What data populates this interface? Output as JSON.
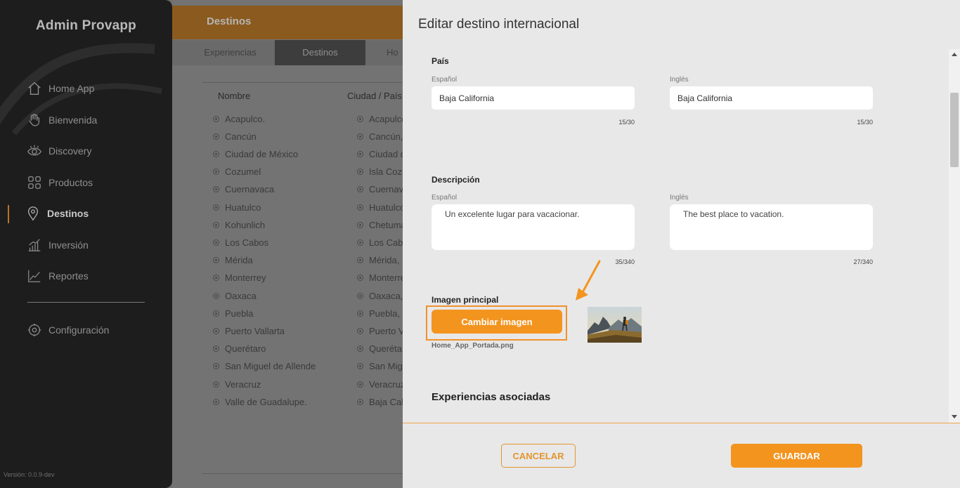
{
  "sidebar": {
    "app_title": "Admin Provapp",
    "items": [
      {
        "label": "Home App",
        "icon": "home-icon"
      },
      {
        "label": "Bienvenida",
        "icon": "wave-hand-icon"
      },
      {
        "label": "Discovery",
        "icon": "eye-icon"
      },
      {
        "label": "Productos",
        "icon": "grid-icon"
      },
      {
        "label": "Destinos",
        "icon": "location-pin-icon",
        "active": true
      },
      {
        "label": "Inversión",
        "icon": "bar-chart-icon"
      },
      {
        "label": "Reportes",
        "icon": "line-chart-icon"
      },
      {
        "label": "Configuración",
        "icon": "gear-icon"
      }
    ],
    "version": "Versión: 0.0.9-dev"
  },
  "background_page": {
    "header_title": "Destinos",
    "tabs": [
      "Experiencias",
      "Destinos",
      "Ho"
    ],
    "selected_tab": "Destinos",
    "columns": [
      "Nombre",
      "Ciudad / País"
    ],
    "rows": [
      [
        "Acapulco.",
        "Acapulco"
      ],
      [
        "Cancún",
        "Cancún,"
      ],
      [
        "Ciudad de México",
        "Ciudad d"
      ],
      [
        "Cozumel",
        "Isla Cozu"
      ],
      [
        "Cuernavaca",
        "Cuernava"
      ],
      [
        "Huatulco",
        "Huatulco"
      ],
      [
        "Kohunlich",
        "Chetuma"
      ],
      [
        "Los Cabos",
        "Los Cab"
      ],
      [
        "Mérida",
        "Mérida,"
      ],
      [
        "Monterrey",
        "Monterre"
      ],
      [
        "Oaxaca",
        "Oaxaca,"
      ],
      [
        "Puebla",
        "Puebla,"
      ],
      [
        "Puerto Vallarta",
        "Puerto V"
      ],
      [
        "Querétaro",
        "Querétar"
      ],
      [
        "San Miguel de Allende",
        "San Mig"
      ],
      [
        "Veracruz",
        "Veracruz"
      ],
      [
        "Valle de Guadalupe.",
        "Baja Cal"
      ]
    ]
  },
  "modal": {
    "title": "Editar destino internacional",
    "pais": {
      "title": "País",
      "es_label": "Español",
      "en_label": "Inglés",
      "es_value": "Baja California",
      "en_value": "Baja California",
      "es_counter": "15/30",
      "en_counter": "15/30"
    },
    "descripcion": {
      "title": "Descripción",
      "es_label": "Español",
      "en_label": "Inglés",
      "es_value": "Un excelente lugar para vacacionar.",
      "en_value": "The best place to vacation.",
      "es_counter": "35/340",
      "en_counter": "27/340"
    },
    "imagen": {
      "title": "Imagen principal",
      "button": "Cambiar imagen",
      "file_name": "Home_App_Portada.png"
    },
    "experiencias_title": "Experiencias asociadas",
    "cancel": "CANCELAR",
    "save": "GUARDAR"
  },
  "colors": {
    "accent": "#f3941f",
    "sidebar_bg": "#1d1d1d",
    "modal_bg": "#e8e8e8"
  }
}
